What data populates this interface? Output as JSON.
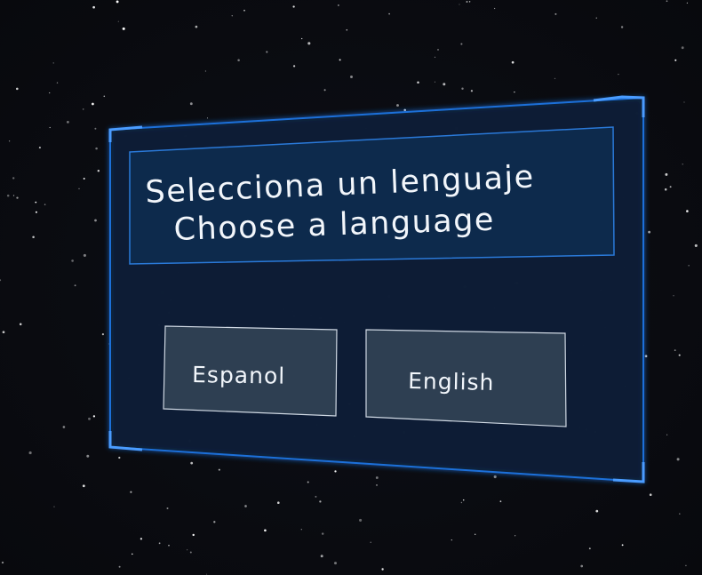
{
  "dialog": {
    "title_line1": "Selecciona un lenguaje",
    "title_line2": "Choose a language"
  },
  "buttons": {
    "spanish_label": "Espanol",
    "english_label": "English"
  },
  "colors": {
    "background": "#0a0b10",
    "panel_fill": "#0b1d35",
    "panel_border": "#1e6fd9",
    "header_fill": "#0d2a4c",
    "button_fill": "#2e3f52",
    "button_border": "#cfd8e3",
    "text": "#f2f6fb"
  }
}
